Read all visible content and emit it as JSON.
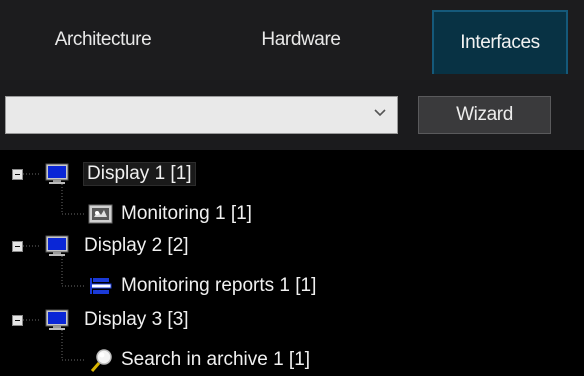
{
  "tabs": [
    {
      "label": "Architecture",
      "active": false
    },
    {
      "label": "Hardware",
      "active": false
    },
    {
      "label": "Interfaces",
      "active": true
    }
  ],
  "toolbar": {
    "combo_value": "",
    "wizard_label": "Wizard"
  },
  "tree": {
    "nodes": [
      {
        "label": "Display 1 [1]",
        "icon": "monitor-icon",
        "selected": true,
        "children": [
          {
            "label": "Monitoring 1 [1]",
            "icon": "monitoring-icon"
          }
        ]
      },
      {
        "label": "Display 2 [2]",
        "icon": "monitor-icon",
        "children": [
          {
            "label": "Monitoring reports 1 [1]",
            "icon": "reports-icon"
          }
        ]
      },
      {
        "label": "Display 3 [3]",
        "icon": "monitor-icon",
        "children": [
          {
            "label": "Search in archive 1 [1]",
            "icon": "search-archive-icon"
          }
        ]
      }
    ]
  },
  "colors": {
    "background": "#000000",
    "tabbar": "#1c1c1e",
    "active_tab": "#083244",
    "active_tab_border": "#15597a",
    "text": "#f0f0f0"
  }
}
